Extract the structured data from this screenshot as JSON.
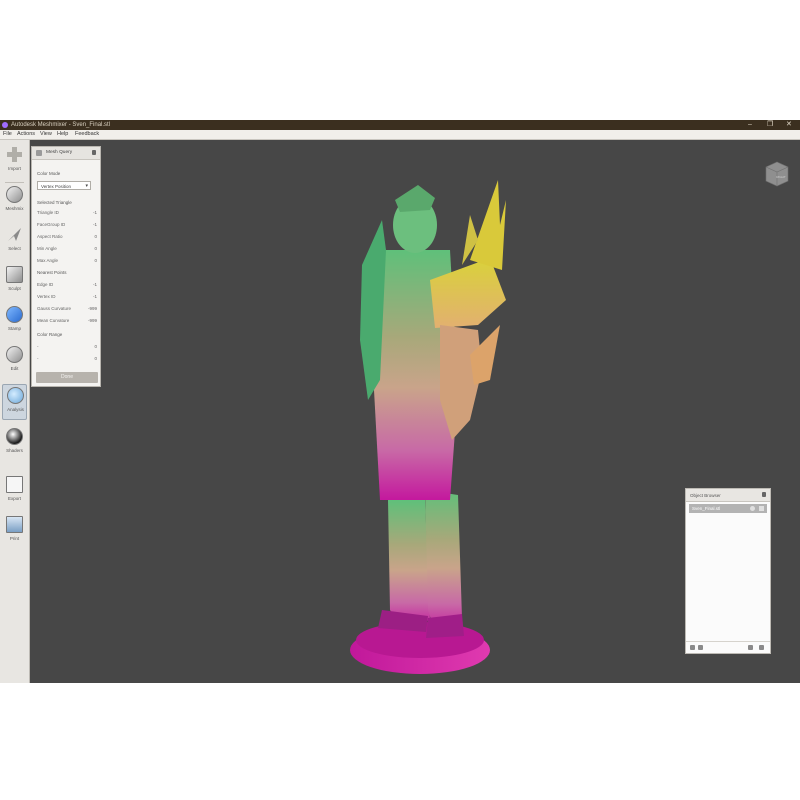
{
  "window": {
    "title": "Autodesk Meshmixer - Sven_Final.stl",
    "minimize_glyph": "–",
    "maximize_glyph": "❐",
    "close_glyph": "✕"
  },
  "menu": [
    "File",
    "Actions",
    "View",
    "Help",
    "Feedback"
  ],
  "tools": [
    {
      "label": "Import",
      "icon": "plus-icon"
    },
    {
      "label": "Meshmix",
      "icon": "meshmix-icon"
    },
    {
      "label": "Select",
      "icon": "select-arrow-icon"
    },
    {
      "label": "Sculpt",
      "icon": "sculpt-brush-icon"
    },
    {
      "label": "Stamp",
      "icon": "stamp-icon"
    },
    {
      "label": "Edit",
      "icon": "edit-sphere-icon"
    },
    {
      "label": "Analysis",
      "icon": "analysis-icon"
    },
    {
      "label": "Shaders",
      "icon": "shader-sphere-icon"
    },
    {
      "label": "Export",
      "icon": "export-icon"
    },
    {
      "label": "Print",
      "icon": "print-icon"
    }
  ],
  "mesh_query": {
    "title": "Mesh Query",
    "color_mode_label": "Color Mode",
    "color_mode_value": "Vertex Position",
    "selected_triangle_header": "Selected Triangle",
    "triangle_rows": [
      {
        "key": "Triangle ID",
        "value": "-1"
      },
      {
        "key": "FaceGroup ID",
        "value": "-1"
      },
      {
        "key": "Aspect Ratio",
        "value": "0"
      },
      {
        "key": "Min Angle",
        "value": "0"
      },
      {
        "key": "Max Angle",
        "value": "0"
      }
    ],
    "nearest_points_header": "Nearest Points",
    "point_rows": [
      {
        "key": "Edge ID",
        "value": "-1"
      },
      {
        "key": "Vertex ID",
        "value": "-1"
      },
      {
        "key": "Gauss Curvature",
        "value": "-999"
      },
      {
        "key": "Mean Curvature",
        "value": "-999"
      }
    ],
    "color_range_header": "Color Range",
    "range_rows": [
      {
        "key": "-",
        "value": "0"
      },
      {
        "key": "-",
        "value": "0"
      }
    ],
    "done_label": "Done"
  },
  "nav_cube": {
    "label": "RIGHT"
  },
  "object_browser": {
    "title": "Object Browser",
    "items": [
      {
        "name": "Sven_Final.stl"
      }
    ]
  },
  "colors": {
    "viewport": "#474747",
    "titlebar": "#3b2f1f",
    "model_top": "#5fc07a",
    "model_mid": "#c9a48a",
    "model_bottom": "#c4189e"
  }
}
